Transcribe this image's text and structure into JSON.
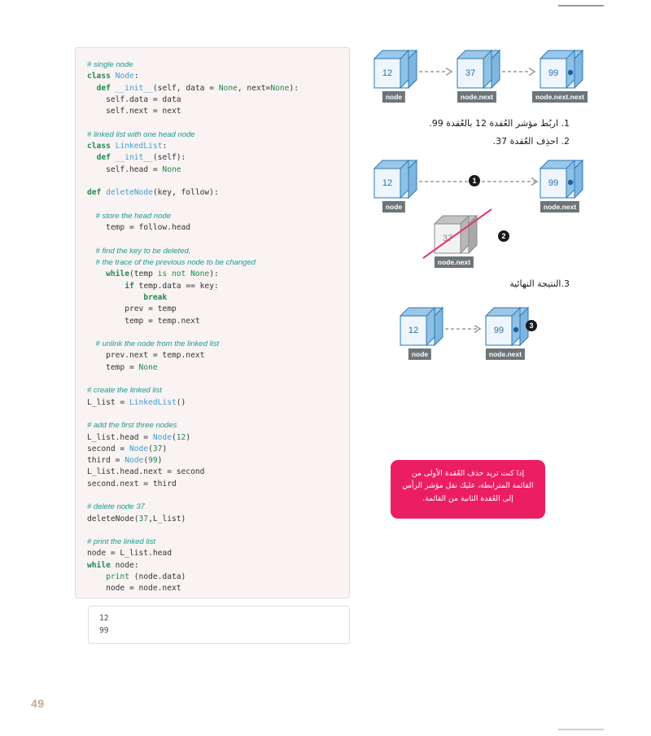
{
  "page": {
    "number": "49",
    "background": "#ffffff",
    "accent_pink": "#ec1e63",
    "node_blue": "#2470a8",
    "comment_teal": "#1a9a8f",
    "keyword_green": "#1f8a4c"
  },
  "code_panel": {
    "language": "python",
    "lines": [
      {
        "type": "comment",
        "text": "# single node"
      },
      {
        "type": "code",
        "text": "class Node:"
      },
      {
        "type": "code",
        "text": "  def __init__(self, data = None, next=None):"
      },
      {
        "type": "code",
        "text": "    self.data = data"
      },
      {
        "type": "code",
        "text": "    self.next = next"
      },
      {
        "type": "blank",
        "text": ""
      },
      {
        "type": "comment",
        "text": "# linked list with one head node"
      },
      {
        "type": "code",
        "text": "class LinkedList:"
      },
      {
        "type": "code",
        "text": "  def __init__(self):"
      },
      {
        "type": "code",
        "text": "    self.head = None"
      },
      {
        "type": "blank",
        "text": ""
      },
      {
        "type": "code",
        "text": "def deleteNode(key, follow):"
      },
      {
        "type": "blank",
        "text": ""
      },
      {
        "type": "comment",
        "text": "    # store the head node"
      },
      {
        "type": "code",
        "text": "    temp = follow.head"
      },
      {
        "type": "blank",
        "text": ""
      },
      {
        "type": "comment",
        "text": "    # find the key to be deleted,"
      },
      {
        "type": "comment",
        "text": "    # the trace of the previous node to be changed"
      },
      {
        "type": "code",
        "text": "    while(temp is not None):"
      },
      {
        "type": "code",
        "text": "        if temp.data == key:"
      },
      {
        "type": "code",
        "text": "            break"
      },
      {
        "type": "code",
        "text": "        prev = temp"
      },
      {
        "type": "code",
        "text": "        temp = temp.next"
      },
      {
        "type": "blank",
        "text": ""
      },
      {
        "type": "comment",
        "text": "    # unlink the node from the linked list"
      },
      {
        "type": "code",
        "text": "    prev.next = temp.next"
      },
      {
        "type": "code",
        "text": "    temp = None"
      },
      {
        "type": "blank",
        "text": ""
      },
      {
        "type": "comment",
        "text": "# create the linked list"
      },
      {
        "type": "code",
        "text": "L_list = LinkedList()"
      },
      {
        "type": "blank",
        "text": ""
      },
      {
        "type": "comment",
        "text": "# add the first three nodes"
      },
      {
        "type": "code",
        "text": "L_list.head = Node(12)"
      },
      {
        "type": "code",
        "text": "second = Node(37)"
      },
      {
        "type": "code",
        "text": "third = Node(99)"
      },
      {
        "type": "code",
        "text": "L_list.head.next = second"
      },
      {
        "type": "code",
        "text": "second.next = third"
      },
      {
        "type": "blank",
        "text": ""
      },
      {
        "type": "comment",
        "text": "# delete node 37"
      },
      {
        "type": "code",
        "text": "deleteNode(37,L_list)"
      },
      {
        "type": "blank",
        "text": ""
      },
      {
        "type": "comment",
        "text": "# print the linked list"
      },
      {
        "type": "code",
        "text": "node = L_list.head"
      },
      {
        "type": "code",
        "text": "while node:"
      },
      {
        "type": "code",
        "text": "    print (node.data)"
      },
      {
        "type": "code",
        "text": "    node = node.next"
      }
    ]
  },
  "output_panel": {
    "lines": [
      "12",
      "99"
    ]
  },
  "diagram_initial": {
    "caption": "",
    "nodes": [
      {
        "value": "12",
        "label": "node",
        "null_pointer": false,
        "deleted": false
      },
      {
        "value": "37",
        "label": "node.next",
        "null_pointer": false,
        "deleted": false
      },
      {
        "value": "99",
        "label": "node.next.next",
        "null_pointer": true,
        "deleted": false
      }
    ]
  },
  "steps_text": {
    "step1": "1. اربُط مؤشر العُقدة 12 بالعُقدة 99.",
    "step2": "2. احذِف العُقدة 37.",
    "step3": "3.النتيجة النهائية"
  },
  "diagram_middle": {
    "nodes": [
      {
        "value": "12",
        "label": "node",
        "null_pointer": false,
        "deleted": false
      },
      {
        "value": "99",
        "label": "node.next",
        "null_pointer": true,
        "deleted": false
      },
      {
        "value": "37",
        "label": "node.next",
        "null_pointer": false,
        "deleted": true
      }
    ],
    "badges": [
      "1",
      "2"
    ]
  },
  "diagram_final": {
    "nodes": [
      {
        "value": "12",
        "label": "node",
        "null_pointer": false,
        "deleted": false
      },
      {
        "value": "99",
        "label": "node.next",
        "null_pointer": true,
        "deleted": false
      }
    ],
    "badges": [
      "3"
    ]
  },
  "info_box": {
    "text": "إذا كنت تريد حذف العُقدة الأولى من القائمة المترابطة، عليك نقل مؤشر الرأس إلى العُقدة الثانية من القائمة.",
    "color": "#ec1e63"
  }
}
